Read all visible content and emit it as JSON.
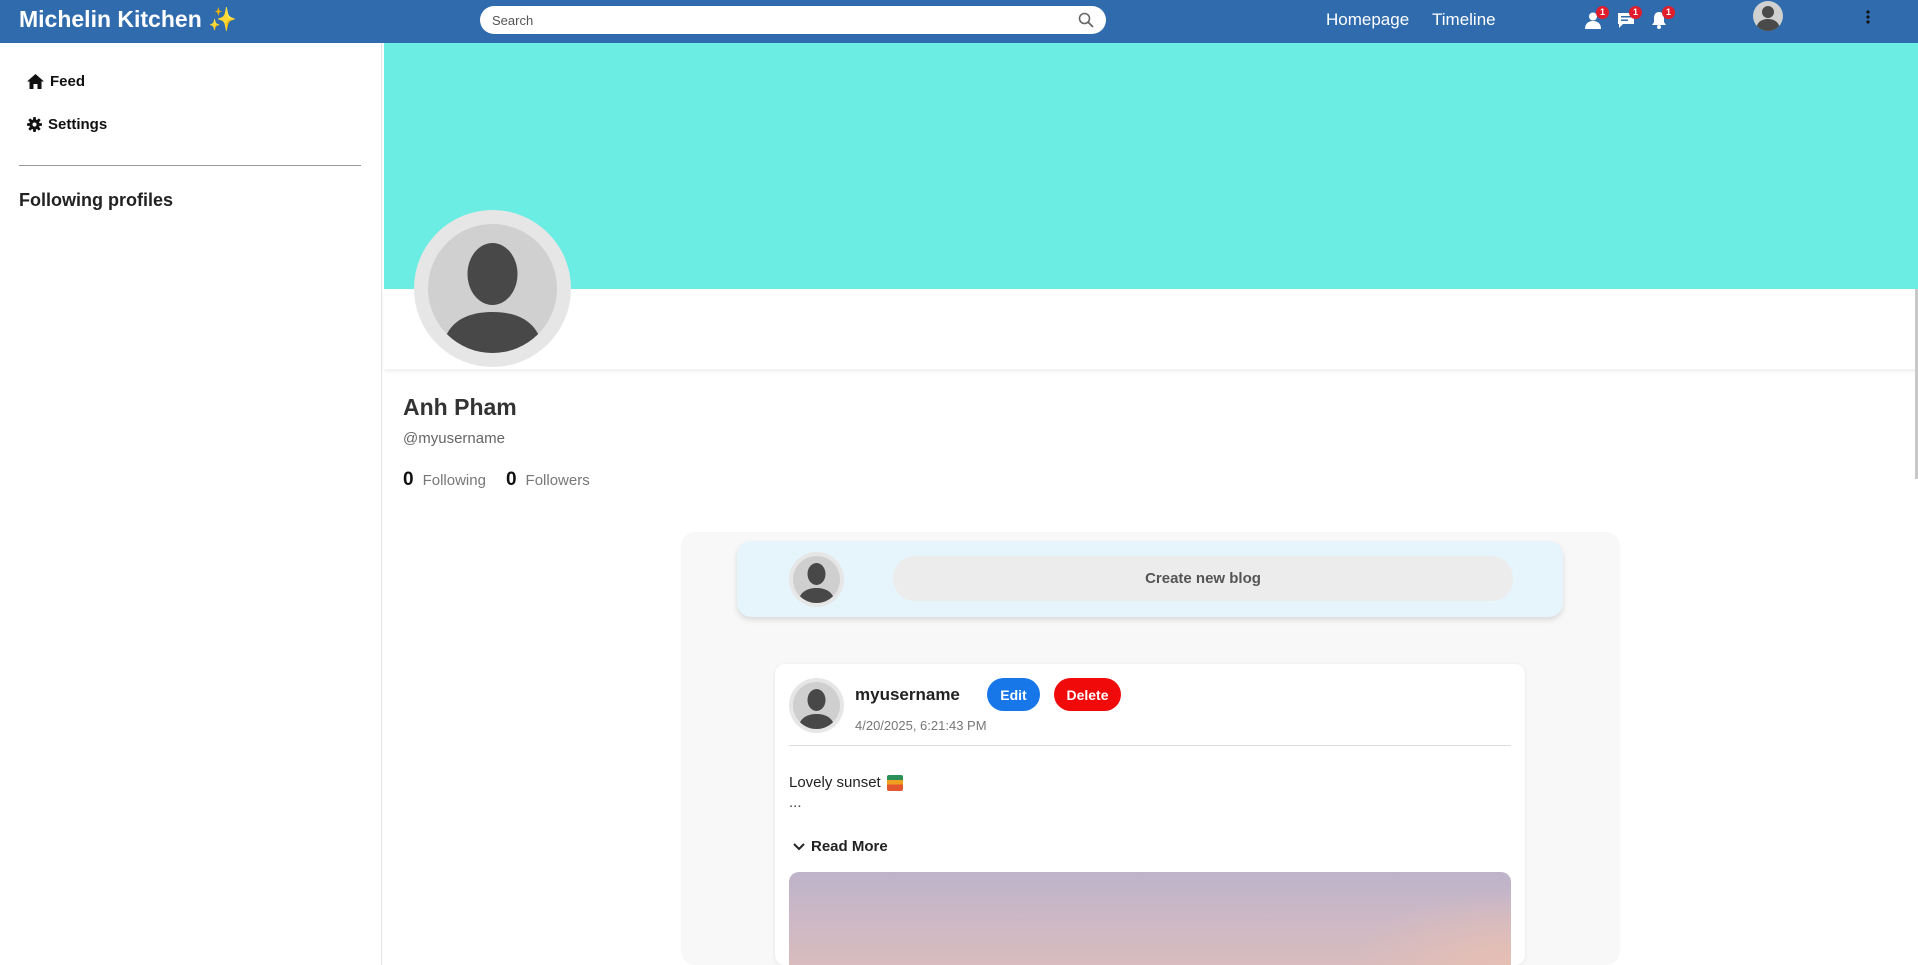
{
  "topbar": {
    "brand": "Michelin Kitchen ✨",
    "search_placeholder": "Search",
    "nav": {
      "homepage": "Homepage",
      "timeline": "Timeline"
    },
    "icons": [
      {
        "name": "friend-request-icon",
        "badge": "1"
      },
      {
        "name": "messages-icon",
        "badge": "1"
      },
      {
        "name": "notifications-icon",
        "badge": "1"
      }
    ],
    "color": "#2f6bad"
  },
  "sidebar": {
    "items": [
      {
        "label": "Feed",
        "icon": "home-icon"
      },
      {
        "label": "Settings",
        "icon": "gear-icon"
      }
    ],
    "following_title": "Following profiles"
  },
  "profile": {
    "cover_color": "#6cede3",
    "name": "Anh Pham",
    "handle": "@myusername",
    "following_count": "0",
    "following_label": "Following",
    "followers_count": "0",
    "followers_label": "Followers"
  },
  "composer": {
    "create_label": "Create new blog"
  },
  "post": {
    "username": "myusername",
    "edit_label": "Edit",
    "delete_label": "Delete",
    "date": "4/20/2025, 6:21:43 PM",
    "text": "Lovely sunset",
    "ellipsis": "...",
    "read_more": "Read More",
    "edit_color": "#1877e8",
    "delete_color": "#f00a0a"
  }
}
